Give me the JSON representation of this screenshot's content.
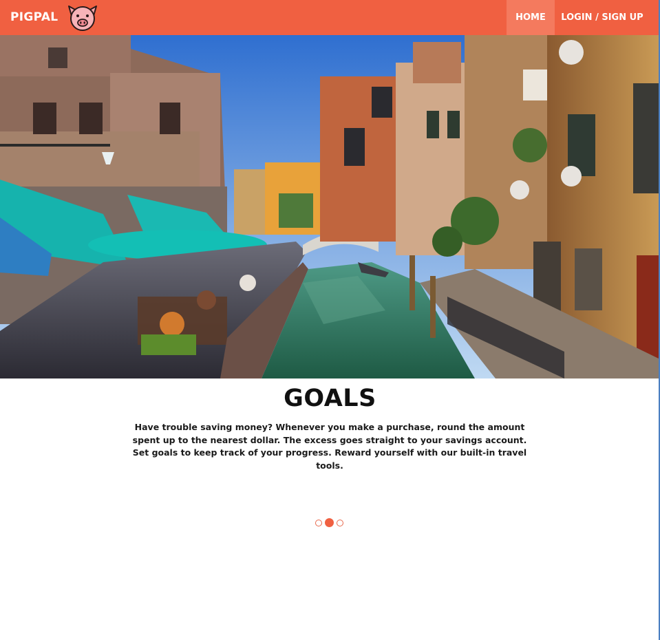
{
  "brand": {
    "name": "PIGPAL",
    "logo_icon": "pig-face-icon"
  },
  "nav": {
    "items": [
      {
        "label": "HOME",
        "active": true
      },
      {
        "label": "LOGIN / SIGN UP",
        "active": false
      }
    ]
  },
  "hero": {
    "image": "venice-canal-photo"
  },
  "content": {
    "title": "GOALS",
    "description": "Have trouble saving money? Whenever you make a purchase, round the amount spent up to the nearest dollar. The excess goes straight to your savings account. Set goals to keep track of your progress. Reward yourself with our built-in travel tools."
  },
  "carousel": {
    "slide_count": 3,
    "active_index": 1
  },
  "colors": {
    "brand": "#f06041",
    "active_nav": "#f47a5e"
  }
}
